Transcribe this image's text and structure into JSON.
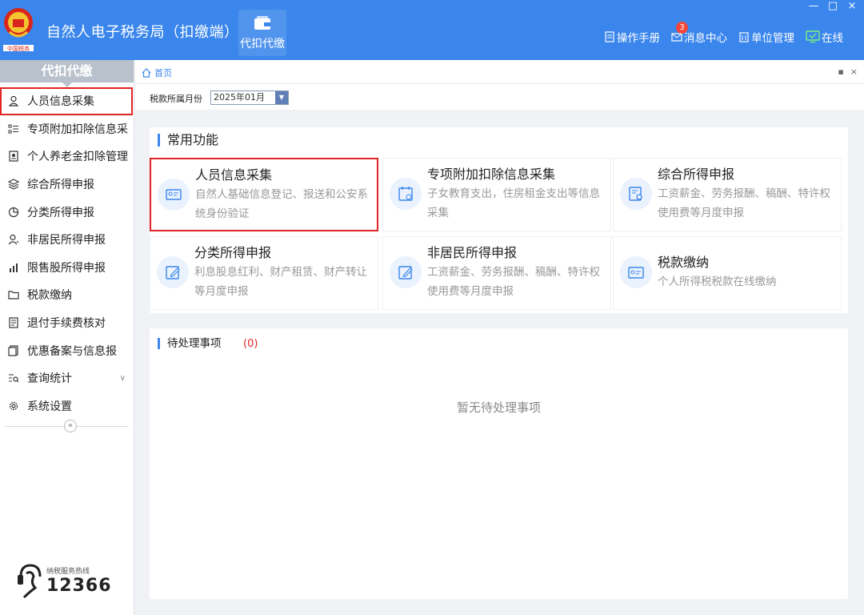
{
  "window": {
    "title": "自然人电子税务局（扣缴端）",
    "logo_text": "中国税务",
    "controls": [
      "—",
      "□",
      "×"
    ]
  },
  "toolbar": {
    "module_button": "代扣代缴",
    "module_icon": "wallet-icon"
  },
  "top_links": {
    "manual": "操作手册",
    "messages": "消息中心",
    "messages_badge": "3",
    "unit": "单位管理",
    "online": "在线"
  },
  "sidebar": {
    "header": "代扣代缴",
    "items": [
      {
        "label": "人员信息采集",
        "icon": "person-icon"
      },
      {
        "label": "专项附加扣除信息采",
        "icon": "list-icon"
      },
      {
        "label": "个人养老金扣除管理",
        "icon": "pension-icon"
      },
      {
        "label": "综合所得申报",
        "icon": "layers-icon"
      },
      {
        "label": "分类所得申报",
        "icon": "pie-icon"
      },
      {
        "label": "非居民所得申报",
        "icon": "nonresident-icon"
      },
      {
        "label": "限售股所得申报",
        "icon": "bar-chart-icon"
      },
      {
        "label": "税款缴纳",
        "icon": "folder-icon"
      },
      {
        "label": "退付手续费核对",
        "icon": "receipt-icon"
      },
      {
        "label": "优惠备案与信息报",
        "icon": "document-icon"
      },
      {
        "label": "查询统计",
        "icon": "search-list-icon"
      },
      {
        "label": "系统设置",
        "icon": "gear-icon"
      }
    ],
    "collapse": "«",
    "hotline_label": "纳税服务热线",
    "hotline_number": "12366"
  },
  "tabs": {
    "home": "首页"
  },
  "filter": {
    "label": "税款所属月份",
    "value": "2025年01月"
  },
  "common_functions": {
    "title": "常用功能",
    "cards": [
      {
        "title": "人员信息采集",
        "desc": "自然人基础信息登记、报送和公安系统身份验证",
        "icon": "id-card-icon"
      },
      {
        "title": "专项附加扣除信息采集",
        "desc": "子女教育支出，住房租金支出等信息采集",
        "icon": "calendar-tax-icon"
      },
      {
        "title": "综合所得申报",
        "desc": "工资薪金、劳务报酬、稿酬、特许权使用费等月度申报",
        "icon": "form-search-icon"
      },
      {
        "title": "分类所得申报",
        "desc": "利息股息红利、财产租赁、财产转让等月度申报",
        "icon": "edit-icon"
      },
      {
        "title": "非居民所得申报",
        "desc": "工资薪金、劳务报酬、稿酬、特许权使用费等月度申报",
        "icon": "edit-icon"
      },
      {
        "title": "税款缴纳",
        "desc": "个人所得税税款在线缴纳",
        "icon": "tax-payment-icon"
      }
    ]
  },
  "pending": {
    "title": "待处理事项",
    "count": "(0)",
    "empty": "暂无待处理事项"
  },
  "colors": {
    "primary": "#3a86ec",
    "highlight": "#e32424",
    "sidebar_header": "#b9c1cc"
  }
}
